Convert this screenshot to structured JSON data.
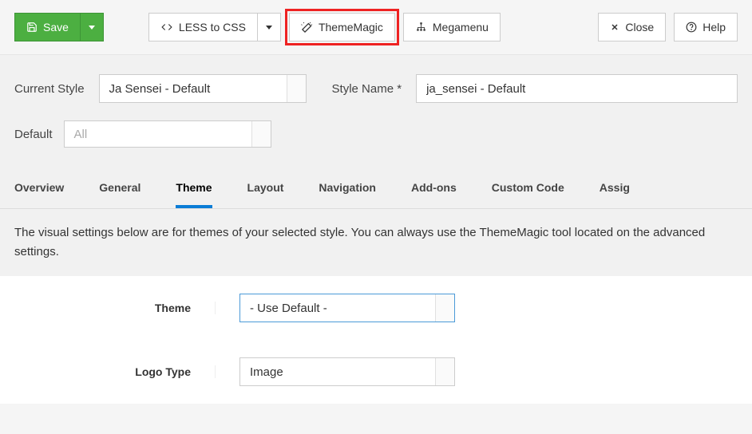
{
  "toolbar": {
    "save_label": "Save",
    "less_to_css_label": "LESS to CSS",
    "thememagic_label": "ThemeMagic",
    "megamenu_label": "Megamenu",
    "close_label": "Close",
    "help_label": "Help"
  },
  "styleRow": {
    "current_style_label": "Current Style",
    "current_style_value": "Ja Sensei - Default",
    "style_name_label": "Style Name *",
    "style_name_value": "ja_sensei - Default"
  },
  "defaultRow": {
    "label": "Default",
    "value": "All"
  },
  "tabs": [
    "Overview",
    "General",
    "Theme",
    "Layout",
    "Navigation",
    "Add-ons",
    "Custom Code",
    "Assig"
  ],
  "activeTab": 2,
  "desc": "The visual settings below are for themes of your selected style. You can always use the ThemeMagic tool located on the advanced settings.",
  "form": {
    "theme_label": "Theme",
    "theme_value": "- Use Default -",
    "logo_type_label": "Logo Type",
    "logo_type_value": "Image"
  }
}
